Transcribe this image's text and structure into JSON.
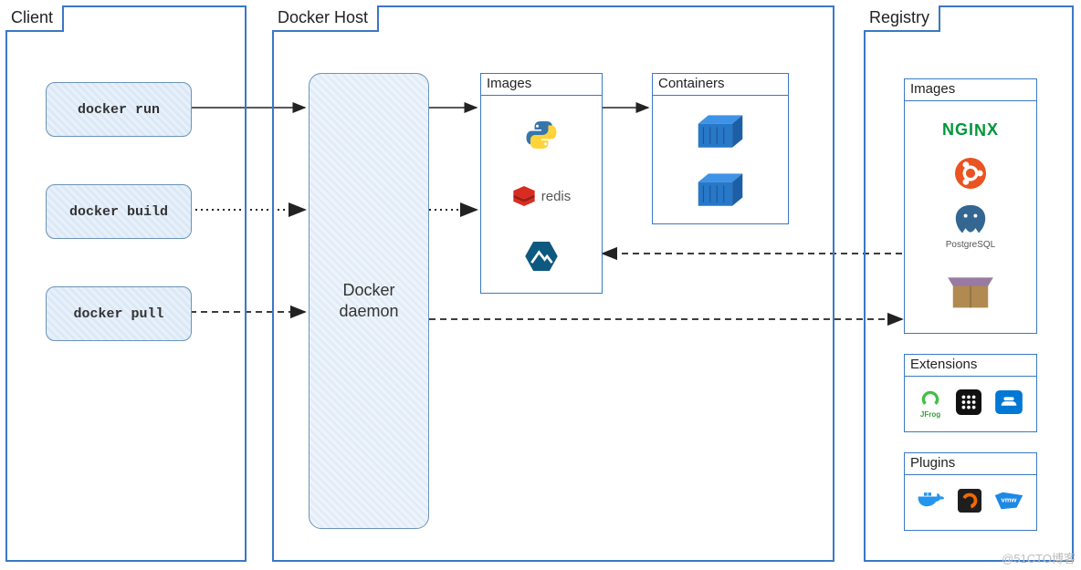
{
  "client": {
    "title": "Client",
    "commands": {
      "run": "docker run",
      "build": "docker build",
      "pull": "docker pull"
    }
  },
  "host": {
    "title": "Docker Host",
    "daemon_label": "Docker\ndaemon",
    "images_title": "Images",
    "containers_title": "Containers",
    "images": [
      "python",
      "redis",
      "alpine"
    ],
    "containers": [
      "container-1",
      "container-2"
    ]
  },
  "registry": {
    "title": "Registry",
    "images_title": "Images",
    "extensions_title": "Extensions",
    "plugins_title": "Plugins",
    "images": [
      "nginx",
      "ubuntu",
      "PostgreSQL",
      "box"
    ],
    "extensions": [
      "jfrog",
      "portainer",
      "vscode"
    ],
    "plugins": [
      "docker",
      "grafana",
      "vmw"
    ]
  },
  "arrows": {
    "run_to_daemon": "solid",
    "daemon_to_images": "solid",
    "images_to_containers": "solid",
    "build_to_daemon": "dotted",
    "daemon_to_images_b": "dotted",
    "pull_to_daemon": "dashed",
    "registry_to_images": "dashed",
    "daemon_to_registry": "dashed"
  },
  "watermark": "@51CTO博客"
}
